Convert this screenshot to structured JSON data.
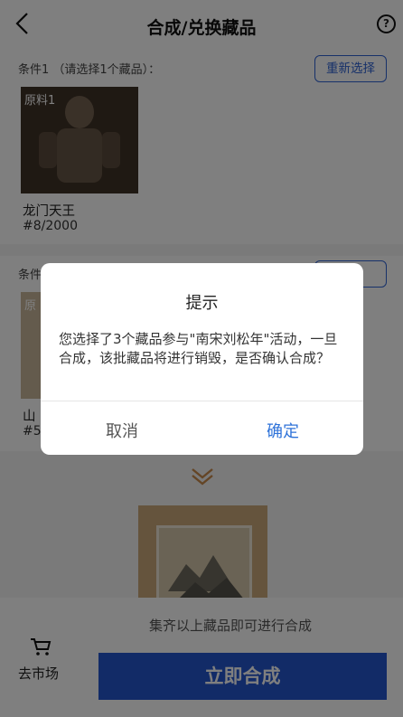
{
  "header": {
    "title": "合成/兑换藏品"
  },
  "conditions": [
    {
      "label": "条件1 （请选择1个藏品）：",
      "reselect_label": "重新选择",
      "tag": "原料1",
      "item_name": "龙门天王",
      "item_number": "#8/2000"
    },
    {
      "label": "条件",
      "reselect_label": "",
      "tag": "原",
      "item_name": "山",
      "item_number": "#5"
    }
  ],
  "bottom": {
    "tip": "集齐以上藏品即可进行合成",
    "market_label": "去市场",
    "synthesize_label": "立即合成"
  },
  "dialog": {
    "title": "提示",
    "message": "您选择了3个藏品参与\"南宋刘松年\"活动，一旦合成，该批藏品将进行销毁，是否确认合成？",
    "cancel_label": "取消",
    "confirm_label": "确定"
  },
  "colors": {
    "accent": "#2556cf",
    "confirm": "#2f73d9",
    "arrow": "#c98a4a"
  },
  "icons": [
    "back-arrow-icon",
    "help-icon",
    "chevron-double-down-icon",
    "cart-icon"
  ]
}
